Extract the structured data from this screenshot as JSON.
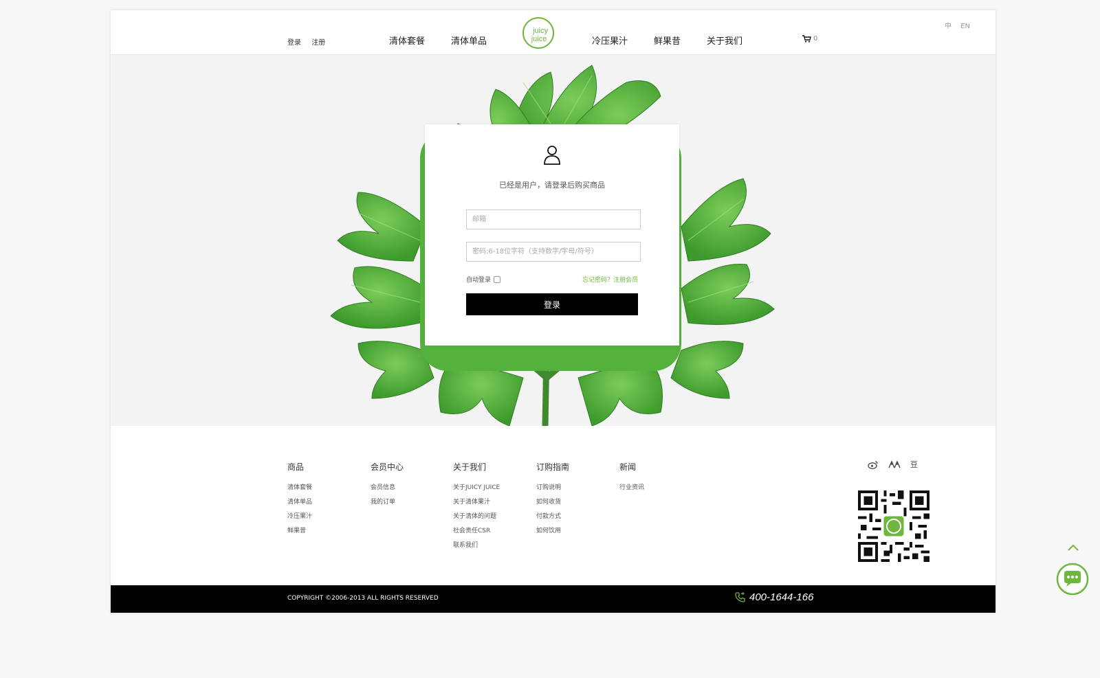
{
  "header": {
    "auth": {
      "login": "登录",
      "register": "注册"
    },
    "nav": [
      "清体套餐",
      "清体单品",
      "冷压果汁",
      "鲜果昔",
      "关于我们"
    ],
    "logo_text": [
      "juicy",
      "juice"
    ],
    "cart_count": "0",
    "lang": [
      "中",
      "EN"
    ]
  },
  "login": {
    "hint": "已经是用户，请登录后购买商品",
    "email_placeholder": "邮箱",
    "password_placeholder": "密码:6-18位字符（支持数字/字母/符号）",
    "remember_label": "自动登录",
    "forgot_link": "忘记密码？注册会员",
    "submit_label": "登录"
  },
  "footer": {
    "columns": [
      {
        "title": "商品",
        "links": [
          "清体套餐",
          "清体单品",
          "冷压果汁",
          "鲜果昔"
        ]
      },
      {
        "title": "会员中心",
        "links": [
          "会员信息",
          "我的订单"
        ]
      },
      {
        "title": "关于我们",
        "links": [
          "关于JUICY JUICE",
          "关于清体果汁",
          "关于清体的问题",
          "社会责任CSR",
          "联系我们"
        ]
      },
      {
        "title": "订购指南",
        "links": [
          "订购说明",
          "如何收货",
          "付款方式",
          "如何饮用"
        ]
      },
      {
        "title": "新闻",
        "links": [
          "行业资讯"
        ]
      }
    ],
    "social": {
      "douban": "豆"
    },
    "copyright": "COPYRIGHT ©2006-2013 ALL RIGHTS RESERVED",
    "phone": "400-1644-166"
  },
  "colors": {
    "accent": "#6fb63f",
    "dark": "#000000",
    "leaf": "#4caf38"
  },
  "icons": [
    "cart-icon",
    "user-icon",
    "weibo-icon",
    "renren-icon",
    "qr-code",
    "back-to-top-icon",
    "chat-icon",
    "phone-icon"
  ]
}
